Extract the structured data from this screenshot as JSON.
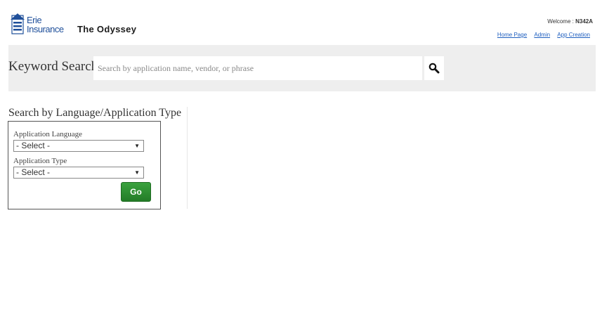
{
  "header": {
    "logo_line1": "Erie",
    "logo_line2": "Insurance",
    "app_title": "The Odyssey",
    "welcome_prefix": "Welcome : ",
    "welcome_user": "N342A",
    "links": [
      "Home Page",
      "Admin",
      "App Creation"
    ]
  },
  "search": {
    "label": "Keyword Search",
    "placeholder": "Search by application name, vendor, or phrase",
    "button_icon": "search-icon"
  },
  "filter": {
    "title": "Search by Language/Application Type",
    "language_label": "Application Language",
    "language_value": "- Select -",
    "type_label": "Application Type",
    "type_value": "- Select -",
    "go_label": "Go"
  },
  "colors": {
    "brand_blue": "#1f4f9a",
    "link_blue": "#1f5fbf",
    "band_gray": "#eeeeee",
    "go_green": "#2e8f32"
  }
}
